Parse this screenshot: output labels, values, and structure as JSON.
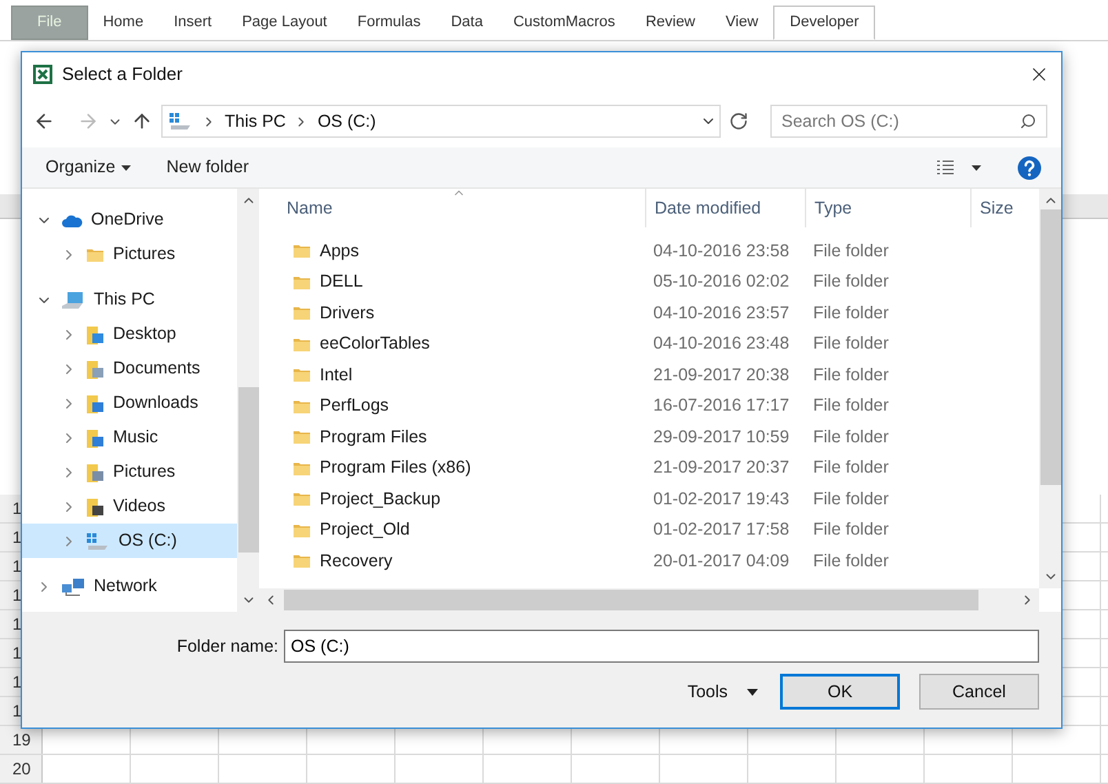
{
  "ribbon": {
    "tabs": [
      {
        "label": "File",
        "kind": "file",
        "selected": false
      },
      {
        "label": "Home",
        "kind": "tab",
        "selected": false
      },
      {
        "label": "Insert",
        "kind": "tab",
        "selected": false
      },
      {
        "label": "Page Layout",
        "kind": "tab",
        "selected": false
      },
      {
        "label": "Formulas",
        "kind": "tab",
        "selected": false
      },
      {
        "label": "Data",
        "kind": "tab",
        "selected": false
      },
      {
        "label": "CustomMacros",
        "kind": "tab",
        "selected": false
      },
      {
        "label": "Review",
        "kind": "tab",
        "selected": false
      },
      {
        "label": "View",
        "kind": "tab",
        "selected": false
      },
      {
        "label": "Developer",
        "kind": "tab",
        "selected": true
      }
    ]
  },
  "sheet": {
    "row_headers": [
      "1",
      "1",
      "1",
      "1",
      "1",
      "1",
      "1",
      "1",
      "19",
      "20"
    ]
  },
  "dialog": {
    "title": "Select a Folder",
    "address": {
      "segments": [
        "This PC",
        "OS (C:)"
      ]
    },
    "search": {
      "placeholder": "Search OS (C:)"
    },
    "toolbar": {
      "organize": "Organize",
      "new_folder": "New folder"
    },
    "nav": [
      {
        "label": "OneDrive",
        "kind": "cloud",
        "expanded": true,
        "selected": false,
        "children": [
          {
            "label": "Pictures",
            "kind": "folder",
            "expanded": false,
            "selected": false
          }
        ]
      },
      {
        "label": "This PC",
        "kind": "pc",
        "expanded": true,
        "selected": false,
        "children": [
          {
            "label": "Desktop",
            "kind": "desktop",
            "expanded": false,
            "selected": false
          },
          {
            "label": "Documents",
            "kind": "documents",
            "expanded": false,
            "selected": false
          },
          {
            "label": "Downloads",
            "kind": "downloads",
            "expanded": false,
            "selected": false
          },
          {
            "label": "Music",
            "kind": "music",
            "expanded": false,
            "selected": false
          },
          {
            "label": "Pictures",
            "kind": "pictures",
            "expanded": false,
            "selected": false
          },
          {
            "label": "Videos",
            "kind": "videos",
            "expanded": false,
            "selected": false
          },
          {
            "label": "OS (C:)",
            "kind": "drive",
            "expanded": false,
            "selected": true
          }
        ]
      },
      {
        "label": "Network",
        "kind": "network",
        "expanded": false,
        "selected": false
      }
    ],
    "columns": [
      "Name",
      "Date modified",
      "Type",
      "Size"
    ],
    "rows": [
      {
        "name": "Apps",
        "date": "04-10-2016 23:58",
        "type": "File folder"
      },
      {
        "name": "DELL",
        "date": "05-10-2016 02:02",
        "type": "File folder"
      },
      {
        "name": "Drivers",
        "date": "04-10-2016 23:57",
        "type": "File folder"
      },
      {
        "name": "eeColorTables",
        "date": "04-10-2016 23:48",
        "type": "File folder"
      },
      {
        "name": "Intel",
        "date": "21-09-2017 20:38",
        "type": "File folder"
      },
      {
        "name": "PerfLogs",
        "date": "16-07-2016 17:17",
        "type": "File folder"
      },
      {
        "name": "Program Files",
        "date": "29-09-2017 10:59",
        "type": "File folder"
      },
      {
        "name": "Program Files (x86)",
        "date": "21-09-2017 20:37",
        "type": "File folder"
      },
      {
        "name": "Project_Backup",
        "date": "01-02-2017 19:43",
        "type": "File folder"
      },
      {
        "name": "Project_Old",
        "date": "01-02-2017 17:58",
        "type": "File folder"
      },
      {
        "name": "Recovery",
        "date": "20-01-2017 04:09",
        "type": "File folder"
      }
    ],
    "folder_name": {
      "label": "Folder name:",
      "value": "OS (C:)"
    },
    "tools": "Tools",
    "buttons": [
      {
        "label": "OK",
        "default": true
      },
      {
        "label": "Cancel",
        "default": false
      }
    ]
  }
}
